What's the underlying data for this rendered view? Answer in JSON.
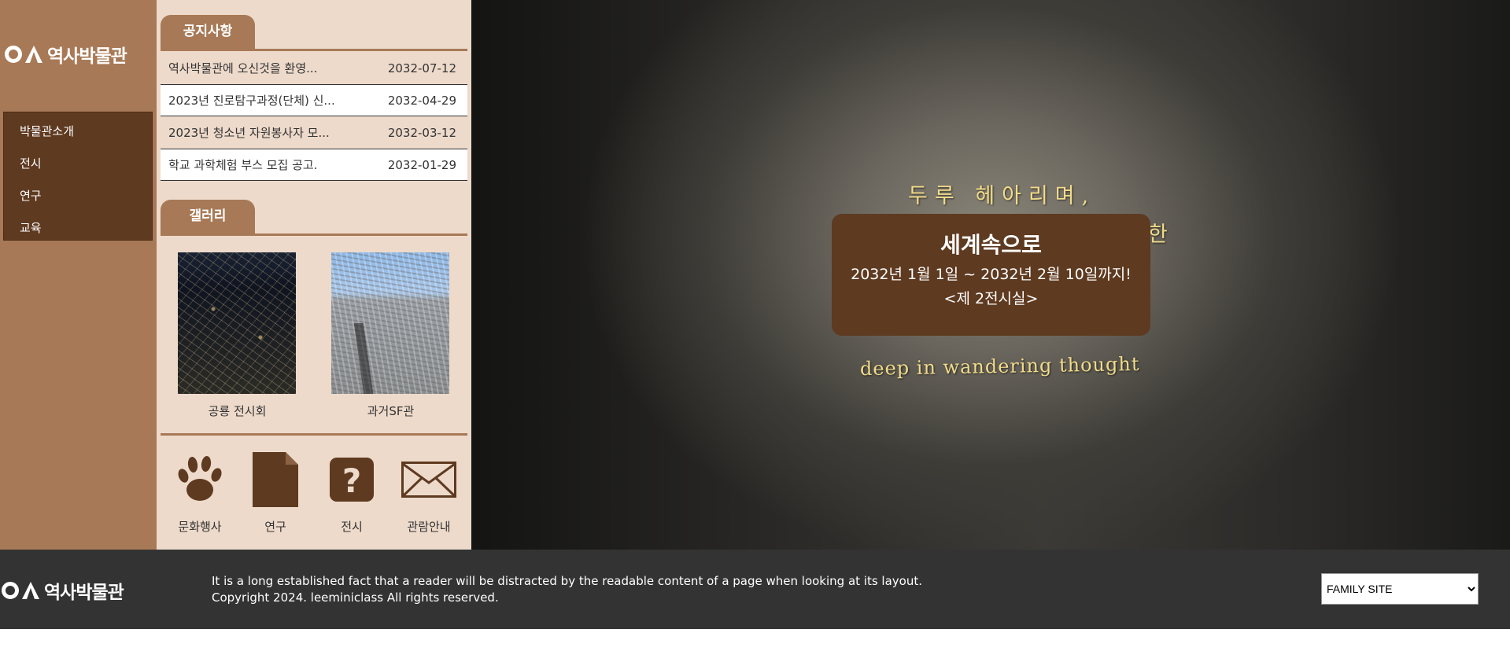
{
  "site": {
    "logo_text": "역사박물관"
  },
  "nav": {
    "items": [
      "박물관소개",
      "전시",
      "연구",
      "교육"
    ]
  },
  "notice": {
    "tab": "공지사항",
    "items": [
      {
        "title": "역사박물관에 오신것을 환영...",
        "date": "2032-07-12"
      },
      {
        "title": "2023년 진로탐구과정(단체) 신...",
        "date": "2032-04-29"
      },
      {
        "title": "2023년 청소년 자원봉사자 모...",
        "date": "2032-03-12"
      },
      {
        "title": "학교 과학체험 부스 모집 공고.",
        "date": "2032-01-29"
      }
    ]
  },
  "gallery": {
    "tab": "갤러리",
    "items": [
      {
        "caption": "공룡 전시회"
      },
      {
        "caption": "과거SF관"
      }
    ]
  },
  "quick": {
    "items": [
      {
        "label": "문화행사",
        "icon": "paw-icon"
      },
      {
        "label": "연구",
        "icon": "document-icon"
      },
      {
        "label": "전시",
        "icon": "question-icon"
      },
      {
        "label": "관람안내",
        "icon": "envelope-icon"
      }
    ]
  },
  "hero": {
    "line1": "두루 헤아리며,",
    "line1_tail": "한",
    "line2": "deep in wandering thought"
  },
  "popup": {
    "title": "세계속으로",
    "line1": "2032년 1월 1일 ~ 2032년 2월 10일까지!",
    "line2": "<제 2전시실>"
  },
  "footer": {
    "logo_text": "역사박물관",
    "text1": "It is a long established fact that a reader will be distracted by the readable content of a page when looking at its layout.",
    "text2": "Copyright 2024. leeminiclass All rights reserved.",
    "family_site": "FAMILY SITE"
  },
  "colors": {
    "brown_dark": "#5e3a20",
    "brown_mid": "#a87956",
    "beige": "#eddacb",
    "footer": "#333333",
    "hero_text": "#f2dc8a"
  }
}
